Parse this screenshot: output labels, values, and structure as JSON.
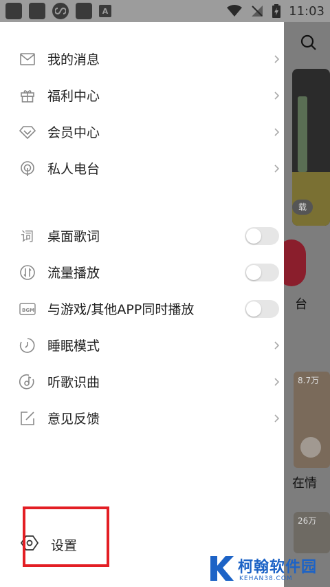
{
  "status_bar": {
    "time": "11:03"
  },
  "drawer": {
    "menu_top": [
      {
        "label": "我的消息",
        "icon": "mail-icon"
      },
      {
        "label": "福利中心",
        "icon": "gift-icon"
      },
      {
        "label": "会员中心",
        "icon": "diamond-icon"
      },
      {
        "label": "私人电台",
        "icon": "radio-icon"
      }
    ],
    "menu_bottom": [
      {
        "label": "桌面歌词",
        "icon": "lyrics-icon",
        "control": "toggle",
        "on": false
      },
      {
        "label": "流量播放",
        "icon": "data-play-icon",
        "control": "toggle",
        "on": false
      },
      {
        "label": "与游戏/其他APP同时播放",
        "icon": "bgm-icon",
        "icon_text": "BGM",
        "control": "toggle",
        "on": false
      },
      {
        "label": "睡眠模式",
        "icon": "sleep-timer-icon",
        "control": "chevron"
      },
      {
        "label": "听歌识曲",
        "icon": "music-recognition-icon",
        "control": "chevron"
      },
      {
        "label": "意见反馈",
        "icon": "feedback-icon",
        "control": "chevron"
      }
    ],
    "settings_label": "设置"
  },
  "background_app": {
    "card_button": "载",
    "text_1": "台",
    "count_1": "8.7万",
    "text_2": "在情",
    "count_2": "26万"
  },
  "watermark": {
    "title": "柯翰软件园",
    "subtitle": "KEHAN38.COM"
  },
  "colors": {
    "highlight_box": "#e31e24",
    "watermark": "#1d63c6",
    "toggle_off": "#e6e6e6"
  }
}
